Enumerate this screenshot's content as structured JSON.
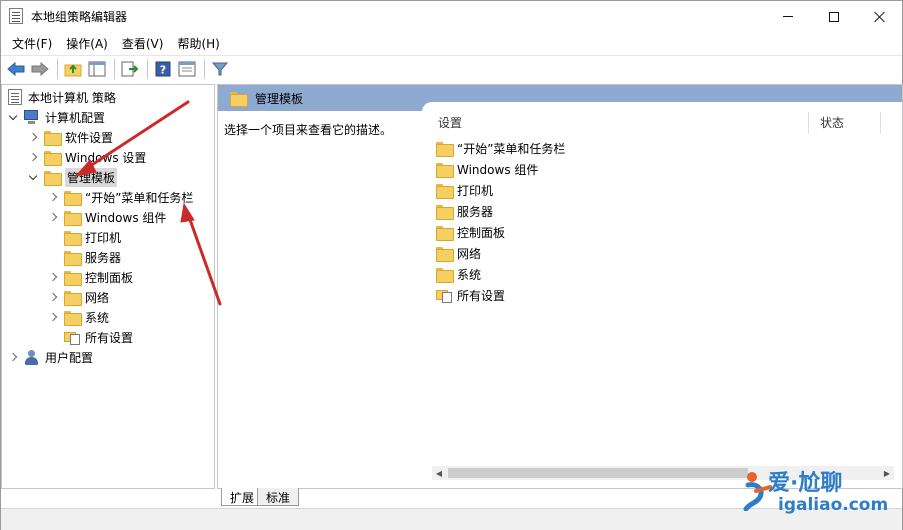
{
  "window": {
    "title": "本地组策略编辑器"
  },
  "menu": {
    "items": [
      {
        "label": "文件(F)"
      },
      {
        "label": "操作(A)"
      },
      {
        "label": "查看(V)"
      },
      {
        "label": "帮助(H)"
      }
    ]
  },
  "tree": {
    "root": "本地计算机 策略",
    "computer_config": "计算机配置",
    "software_settings": "软件设置",
    "windows_settings": "Windows 设置",
    "admin_templates": "管理模板",
    "children": [
      {
        "label": "“开始”菜单和任务栏",
        "expandable": true
      },
      {
        "label": "Windows 组件",
        "expandable": true
      },
      {
        "label": "打印机",
        "expandable": false
      },
      {
        "label": "服务器",
        "expandable": false
      },
      {
        "label": "控制面板",
        "expandable": true
      },
      {
        "label": "网络",
        "expandable": true
      },
      {
        "label": "系统",
        "expandable": true
      },
      {
        "label": "所有设置",
        "expandable": false
      }
    ],
    "user_config": "用户配置"
  },
  "right_pane": {
    "header_title": "管理模板",
    "description": "选择一个项目来查看它的描述。",
    "col_setting": "设置",
    "col_state": "状态",
    "items": [
      {
        "label": "“开始”菜单和任务栏",
        "icon": "folder-icon"
      },
      {
        "label": "Windows 组件",
        "icon": "folder-icon"
      },
      {
        "label": "打印机",
        "icon": "folder-icon"
      },
      {
        "label": "服务器",
        "icon": "folder-icon"
      },
      {
        "label": "控制面板",
        "icon": "folder-icon"
      },
      {
        "label": "网络",
        "icon": "folder-icon"
      },
      {
        "label": "系统",
        "icon": "folder-icon"
      },
      {
        "label": "所有设置",
        "icon": "all-settings-icon"
      }
    ]
  },
  "tabs": {
    "expand": "扩展",
    "standard": "标准"
  },
  "watermark": {
    "cn": "爱·尬聊",
    "en": "igaliao.com"
  },
  "colors": {
    "header_bar": "#8faad0",
    "annotation_arrow": "#cc2a2a",
    "folder": "#f6cf62",
    "watermark": "#2d7ec6"
  }
}
